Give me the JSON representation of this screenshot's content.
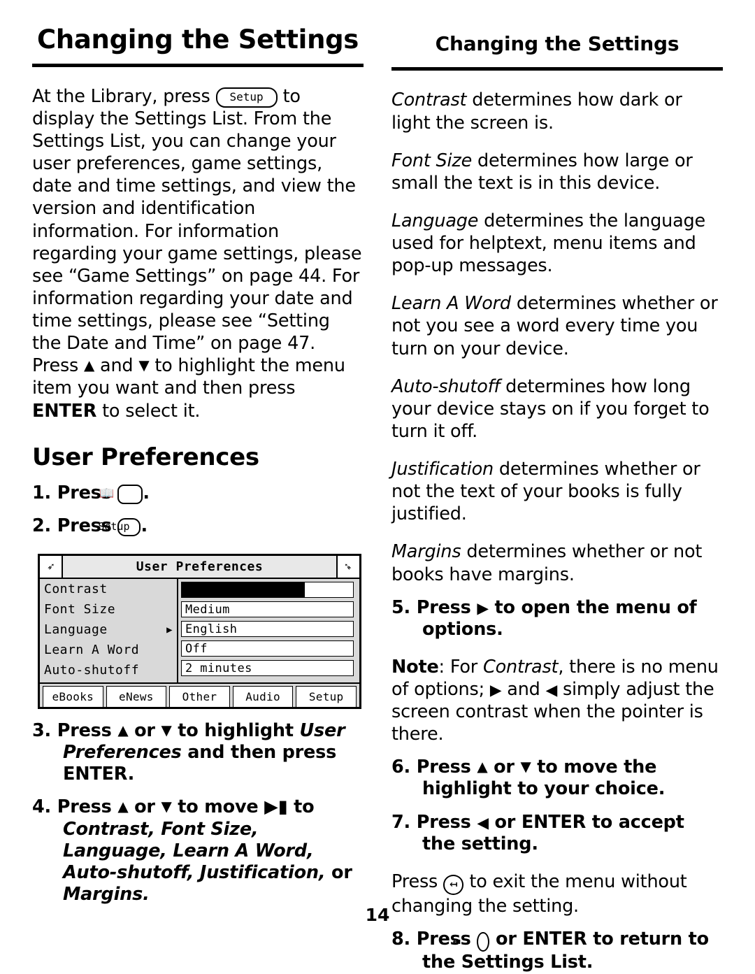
{
  "left": {
    "header": "Changing the Settings",
    "intro_1": "At the Library, press",
    "intro_key": "Setup",
    "intro_2": "to display the Settings List. From the Settings List, you can change your user preferences, game settings, date and time settings, and view the version and identification information. For information regarding your game settings, please see “Game Settings” on page 44. For information regarding your date and time settings, please see “Setting the Date and Time” on page 47. Press",
    "intro_3": "and",
    "intro_4": "to highlight the menu item you want and then press",
    "intro_enter": "ENTER",
    "intro_5": "to select it.",
    "section_title": "User Preferences",
    "step1_num": "1.",
    "step1_text": "Press",
    "step1_key": "📖",
    "step1_end": ".",
    "step2_num": "2.",
    "step2_text": "Press",
    "step2_key": "Setup",
    "step2_end": ".",
    "step3_num": "3.",
    "step3_a": "Press",
    "step3_b": "or",
    "step3_c": "to highlight",
    "step3_italic": "User Preferences",
    "step3_d": "and then press",
    "step3_e": "ENTER.",
    "step4_num": "4.",
    "step4_a": "Press",
    "step4_b": "or",
    "step4_c": "to move",
    "step4_d": "to",
    "step4_italic_list": "Contrast, Font Size, Language, Learn A Word, Auto-shutoff, Justification,",
    "step4_or": "or",
    "step4_last": "Margins."
  },
  "device": {
    "title": "User Preferences",
    "menu_items": [
      {
        "label": "Contrast",
        "pointer": false
      },
      {
        "label": "Font Size",
        "pointer": false
      },
      {
        "label": "Language",
        "pointer": true
      },
      {
        "label": "Learn A Word",
        "pointer": false
      },
      {
        "label": "Auto-shutoff",
        "pointer": false
      }
    ],
    "values": [
      {
        "type": "bar",
        "value": ""
      },
      {
        "type": "text",
        "value": "Medium"
      },
      {
        "type": "text",
        "value": "English"
      },
      {
        "type": "text",
        "value": "Off"
      },
      {
        "type": "text",
        "value": "2 minutes"
      }
    ],
    "tabs": [
      "eBooks",
      "eNews",
      "Other",
      "Audio",
      "Setup"
    ],
    "selected_tab": "Setup"
  },
  "right": {
    "header": "Changing the Settings",
    "defs": [
      {
        "term": "Contrast",
        "text": " determines how dark or light the screen is."
      },
      {
        "term": "Font Size",
        "text": " determines how large or small the text is in this device."
      },
      {
        "term": "Language",
        "text": " determines the language used for helptext, menu items and pop-up messages."
      },
      {
        "term": "Learn A Word",
        "text": " determines whether or not you see a word every time you turn on your device."
      },
      {
        "term": "Auto-shutoff",
        "text": " determines how long your device stays on if you forget to turn it off."
      },
      {
        "term": "Justification",
        "text": " determines whether or not the text of your books is fully justified."
      },
      {
        "term": "Margins",
        "text": " determines whether or not books have margins."
      }
    ],
    "step5_num": "5.",
    "step5_a": "Press",
    "step5_b": "to open the menu of options.",
    "note_label": "Note",
    "note_a": ": For",
    "note_italic": "Contrast",
    "note_b": ", there is no menu of options;",
    "note_c": "and",
    "note_d": "simply adjust the screen contrast when the pointer is there.",
    "step6_num": "6.",
    "step6_a": "Press",
    "step6_b": "or",
    "step6_c": "to move the highlight to your choice.",
    "step7_num": "7.",
    "step7_a": "Press",
    "step7_b": "or ENTER to accept the setting.",
    "press_exit_a": "Press",
    "press_exit_b": "to exit the menu without changing the setting.",
    "step8_num": "8.",
    "step8_a": "Press",
    "step8_b": "or ENTER to return to the Settings List."
  },
  "page_number": "14"
}
